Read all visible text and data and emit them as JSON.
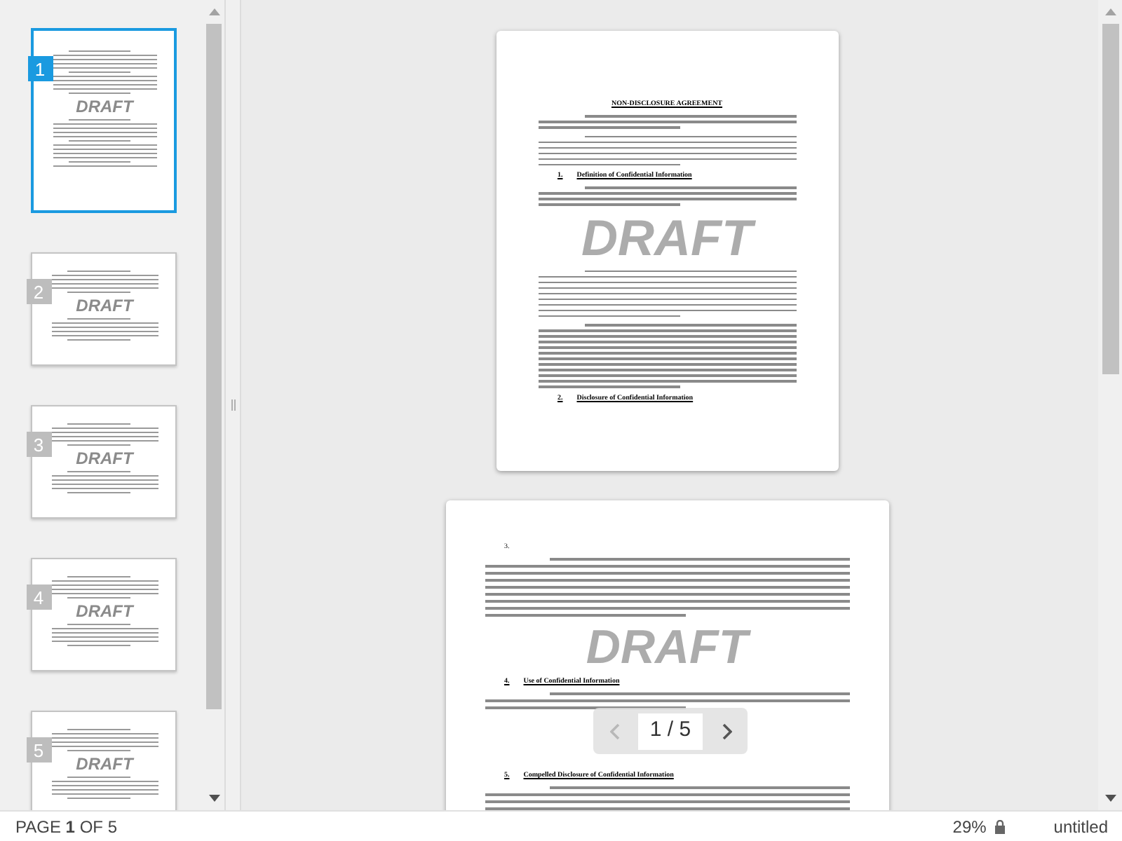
{
  "thumbnails": [
    {
      "number": "1",
      "kind": "portrait",
      "watermark": "DRAFT",
      "selected": true
    },
    {
      "number": "2",
      "kind": "landscape",
      "watermark": "DRAFT",
      "selected": false
    },
    {
      "number": "3",
      "kind": "landscape",
      "watermark": "DRAFT",
      "selected": false
    },
    {
      "number": "4",
      "kind": "landscape",
      "watermark": "DRAFT",
      "selected": false
    },
    {
      "number": "5",
      "kind": "landscape",
      "watermark": "DRAFT",
      "selected": false
    }
  ],
  "pages": [
    {
      "kind": "portrait",
      "blocks": [
        {
          "kind": "title",
          "text": "NON-DISCLOSURE AGREEMENT"
        },
        {
          "kind": "short"
        },
        {
          "kind": "medium"
        },
        {
          "kind": "heading",
          "number": "1.",
          "title": "Definition of Confidential Information"
        },
        {
          "kind": "part"
        },
        {
          "kind": "watermark",
          "text": "DRAFT"
        },
        {
          "kind": "long"
        },
        {
          "kind": "longer"
        },
        {
          "kind": "heading",
          "number": "2.",
          "title": "Disclosure of Confidential Information"
        }
      ]
    },
    {
      "kind": "landscape",
      "blocks": [
        {
          "kind": "number",
          "text": "3."
        },
        {
          "kind": "long"
        },
        {
          "kind": "watermark",
          "text": "DRAFT"
        },
        {
          "kind": "heading",
          "number": "4.",
          "title": "Use of Confidential Information"
        },
        {
          "kind": "short"
        },
        {
          "kind": "heading",
          "number": "5.",
          "title": "Compelled Disclosure of Confidential Information"
        },
        {
          "kind": "longer"
        }
      ]
    }
  ],
  "page_nav": {
    "label": "1 / 5",
    "prev_disabled": true,
    "next_disabled": false
  },
  "status_bar": {
    "page": "PAGE **1** OF 5",
    "zoom": "29%",
    "locked": true,
    "file": "untitled"
  }
}
